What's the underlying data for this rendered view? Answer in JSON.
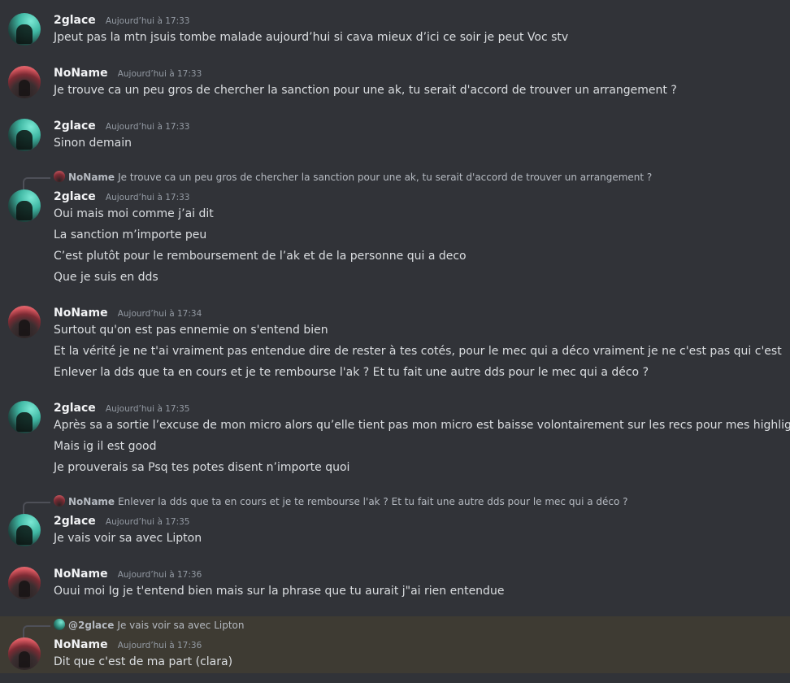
{
  "colors": {
    "background": "#313338",
    "highlight_background": "#3e3b33",
    "username": "#f2f3f5",
    "timestamp": "#949ba4",
    "text": "#dbdee1"
  },
  "messages": [
    {
      "author": "2glace",
      "timestamp": "Aujourd’hui à 17:33",
      "lines": [
        "Jpeut pas la mtn jsuis tombe malade aujourd’hui si cava mieux d’ici ce soir je peut Voc stv"
      ]
    },
    {
      "author": "NoName",
      "timestamp": "Aujourd’hui à 17:33",
      "lines": [
        "Je trouve ca un peu gros de chercher la sanction pour une ak, tu serait d'accord de trouver un arrangement ?"
      ]
    },
    {
      "author": "2glace",
      "timestamp": "Aujourd’hui à 17:33",
      "lines": [
        "Sinon demain"
      ]
    },
    {
      "author": "2glace",
      "timestamp": "Aujourd’hui à 17:33",
      "reply": {
        "name": "NoName",
        "text": "Je trouve ca un peu gros de chercher la sanction pour une ak, tu serait d'accord de trouver un arrangement ?"
      },
      "lines": [
        "Oui mais moi comme j’ai dit",
        "La sanction m’importe peu",
        "C’est plutôt pour le remboursement de l’ak et de la personne qui a deco",
        "Que je suis en dds"
      ]
    },
    {
      "author": "NoName",
      "timestamp": "Aujourd’hui à 17:34",
      "lines": [
        "Surtout qu'on est pas ennemie on s'entend bien",
        "Et la vérité je ne t'ai vraiment pas entendue dire de rester à tes cotés, pour le mec qui a déco vraiment je ne c'est pas qui c'est",
        "Enlever la dds que ta en cours et je te rembourse l'ak ? Et tu fait une autre dds pour le mec qui a déco ?"
      ]
    },
    {
      "author": "2glace",
      "timestamp": "Aujourd’hui à 17:35",
      "lines": [
        "Après sa a sortie l’excuse de mon micro alors qu’elle tient pas mon micro est baisse volontairement sur les recs pour mes highlight",
        "Mais ig il est good",
        "Je prouverais sa Psq tes potes disent n’importe quoi"
      ]
    },
    {
      "author": "2glace",
      "timestamp": "Aujourd’hui à 17:35",
      "reply": {
        "name": "NoName",
        "text": "Enlever la dds que ta en cours et je te rembourse l'ak ? Et tu fait une autre dds pour le mec qui a déco ?"
      },
      "lines": [
        "Je vais voir sa avec Lipton"
      ]
    },
    {
      "author": "NoName",
      "timestamp": "Aujourd’hui à 17:36",
      "lines": [
        "Ouui moi Ig je t'entend bien mais sur la phrase que tu aurait j\"ai rien entendue"
      ]
    },
    {
      "author": "NoName",
      "timestamp": "Aujourd’hui à 17:36",
      "reply": {
        "name": "@2glace",
        "text": "Je vais voir sa avec Lipton"
      },
      "lines": [
        "Dit que c'est de ma part (clara)"
      ]
    }
  ]
}
